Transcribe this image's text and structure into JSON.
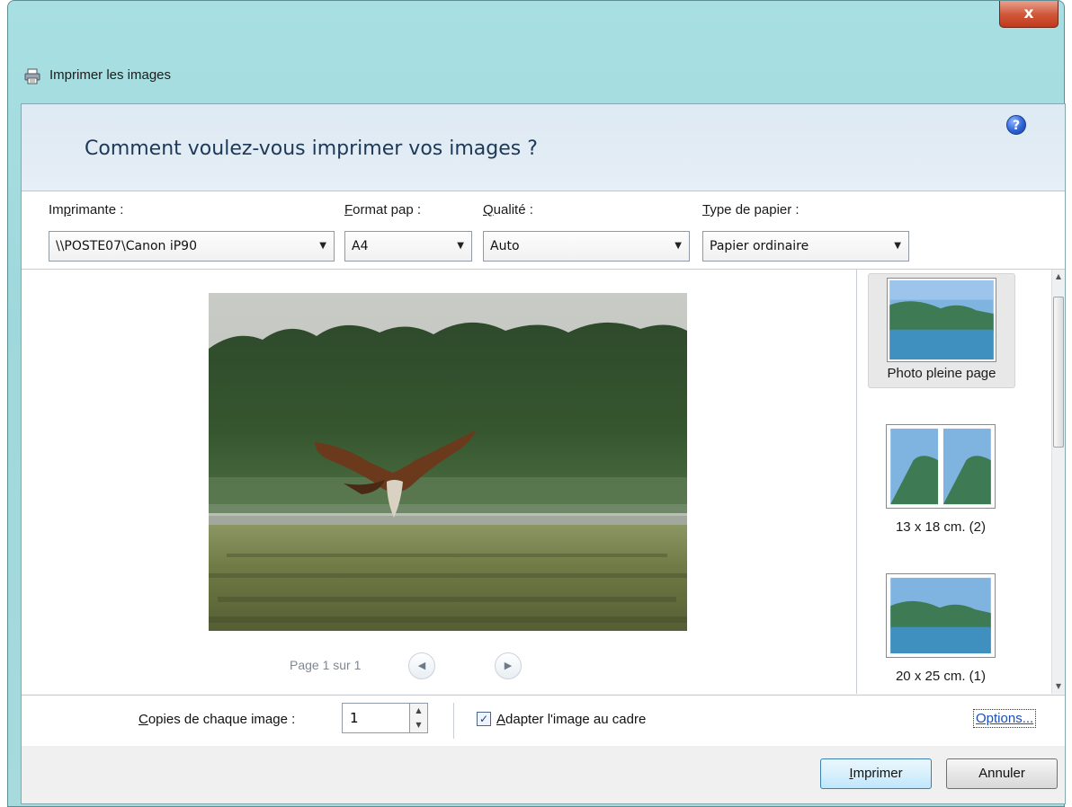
{
  "window": {
    "title": "Imprimer les images",
    "close_label": "x"
  },
  "heading": "Comment voulez-vous imprimer vos images ?",
  "controls": {
    "printer": {
      "label_prefix": "Im",
      "label_access": "p",
      "label_suffix": "rimante :",
      "value": "\\\\POSTE07\\Canon iP90"
    },
    "paper_size": {
      "label_access": "F",
      "label_suffix": "ormat pap :",
      "value": "A4"
    },
    "quality": {
      "label_access": "Q",
      "label_suffix": "ualité :",
      "value": "Auto"
    },
    "paper_type": {
      "label_access": "T",
      "label_suffix": "ype de papier :",
      "value": "Papier ordinaire"
    },
    "help_label": "?"
  },
  "preview": {
    "page_label": "Page 1 sur 1",
    "prev_icon": "◀",
    "next_icon": "▶"
  },
  "layouts": [
    {
      "label": "Photo pleine page",
      "selected": true
    },
    {
      "label": "13 x 18 cm. (2)",
      "selected": false
    },
    {
      "label": "20 x 25 cm. (1)",
      "selected": false
    }
  ],
  "bottom": {
    "copies_label_access": "C",
    "copies_label_suffix": "opies de chaque image :",
    "copies_value": "1",
    "fit_checked": true,
    "fit_check_mark": "✓",
    "fit_label_access": "A",
    "fit_label_suffix": "dapter l'image au cadre",
    "options_label": "Options..."
  },
  "buttons": {
    "print_access": "I",
    "print_suffix": "mprimer",
    "cancel": "Annuler"
  },
  "icons": {
    "title_icon": "printer-icon",
    "help_icon": "help-icon",
    "dropdown_icon": "chevron-down-icon"
  }
}
